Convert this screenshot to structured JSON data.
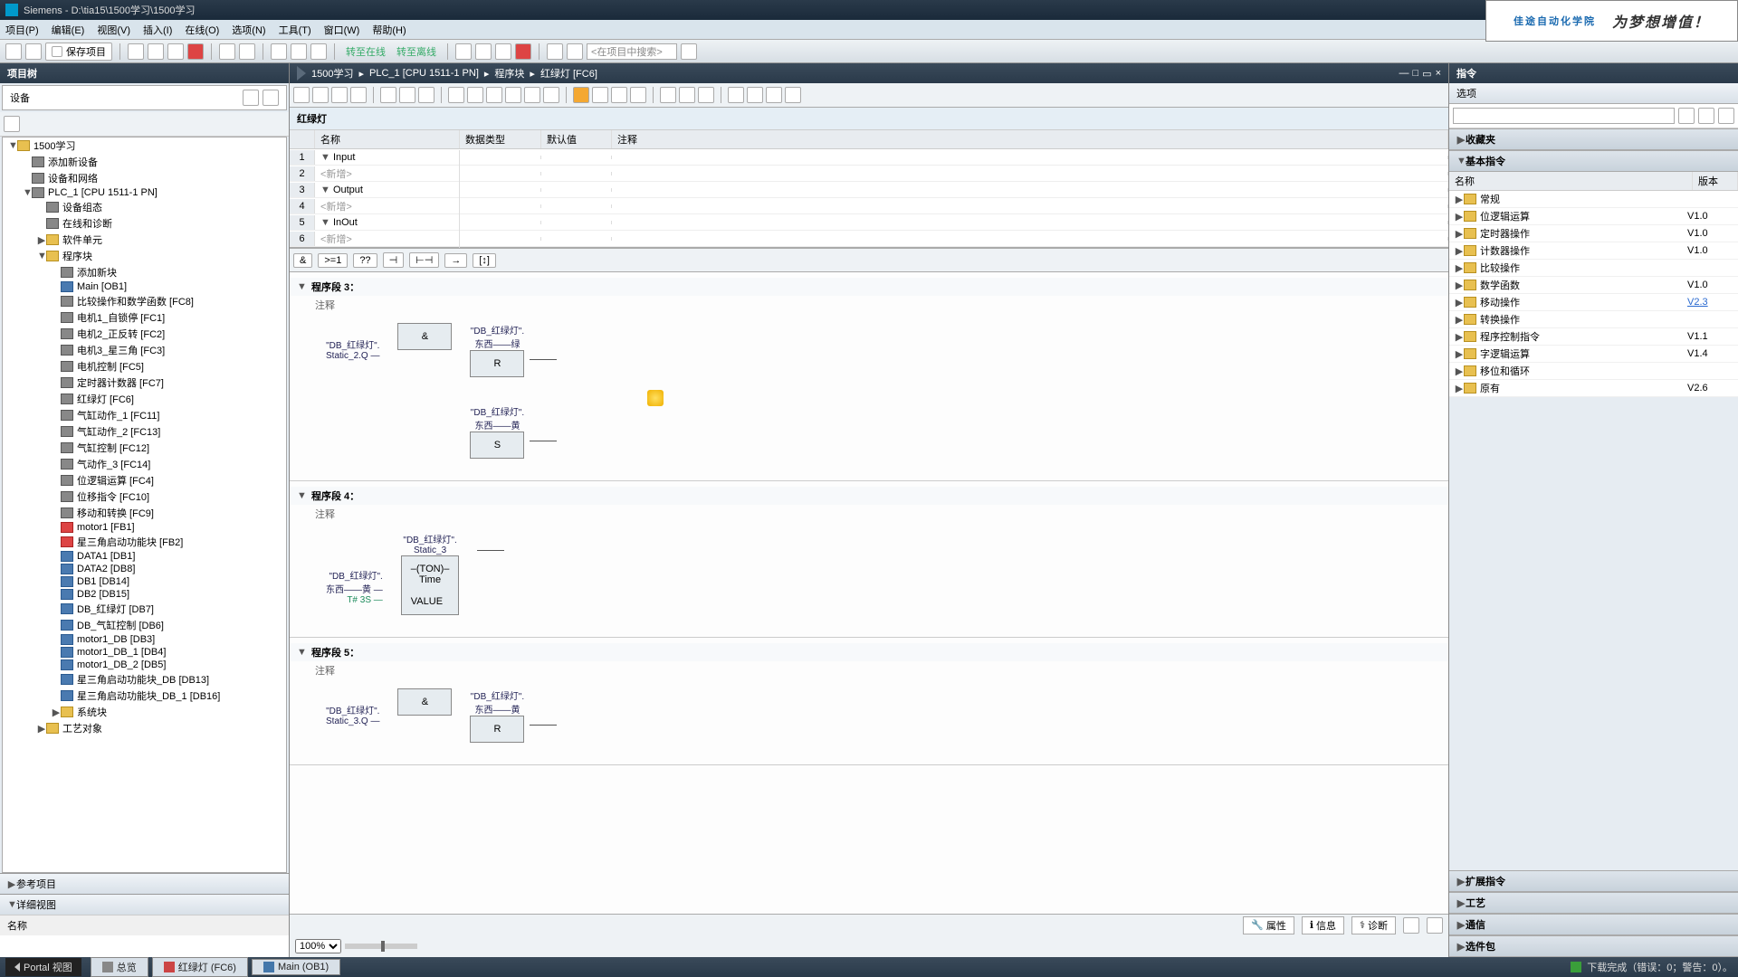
{
  "title": "Siemens  -  D:\\tia15\\1500学习\\1500学习",
  "menus": [
    "项目(P)",
    "编辑(E)",
    "视图(V)",
    "插入(I)",
    "在线(O)",
    "选项(N)",
    "工具(T)",
    "窗口(W)",
    "帮助(H)"
  ],
  "toolbar": {
    "save": "保存项目",
    "go_online": "转至在线",
    "go_offline": "转至离线",
    "search_ph": "<在项目中搜索>"
  },
  "brand": {
    "main": "佳途自动化学院",
    "side": "为梦想增值！"
  },
  "left": {
    "pane": "项目树",
    "devices": "设备",
    "tree": [
      {
        "t": "▼",
        "ic": "folder-ic",
        "lbl": "1500学习",
        "ind": 0
      },
      {
        "t": "",
        "ic": "dev-ic",
        "lbl": "添加新设备",
        "ind": 1
      },
      {
        "t": "",
        "ic": "dev-ic",
        "lbl": "设备和网络",
        "ind": 1
      },
      {
        "t": "▼",
        "ic": "dev-ic",
        "lbl": "PLC_1 [CPU 1511-1 PN]",
        "ind": 1
      },
      {
        "t": "",
        "ic": "dev-ic",
        "lbl": "设备组态",
        "ind": 2
      },
      {
        "t": "",
        "ic": "dev-ic",
        "lbl": "在线和诊断",
        "ind": 2
      },
      {
        "t": "▶",
        "ic": "folder-ic",
        "lbl": "软件单元",
        "ind": 2
      },
      {
        "t": "▼",
        "ic": "folder-ic",
        "lbl": "程序块",
        "ind": 2
      },
      {
        "t": "",
        "ic": "dev-ic",
        "lbl": "添加新块",
        "ind": 3
      },
      {
        "t": "",
        "ic": "db-ic",
        "lbl": "Main [OB1]",
        "ind": 3
      },
      {
        "t": "",
        "ic": "fc-ic",
        "lbl": "比较操作和数学函数 [FC8]",
        "ind": 3
      },
      {
        "t": "",
        "ic": "fc-ic",
        "lbl": "电机1_自锁停 [FC1]",
        "ind": 3
      },
      {
        "t": "",
        "ic": "fc-ic",
        "lbl": "电机2_正反转 [FC2]",
        "ind": 3
      },
      {
        "t": "",
        "ic": "fc-ic",
        "lbl": "电机3_星三角 [FC3]",
        "ind": 3
      },
      {
        "t": "",
        "ic": "fc-ic",
        "lbl": "电机控制 [FC5]",
        "ind": 3
      },
      {
        "t": "",
        "ic": "fc-ic",
        "lbl": "定时器计数器 [FC7]",
        "ind": 3
      },
      {
        "t": "",
        "ic": "fc-ic",
        "lbl": "红绿灯 [FC6]",
        "ind": 3
      },
      {
        "t": "",
        "ic": "fc-ic",
        "lbl": "气缸动作_1 [FC11]",
        "ind": 3
      },
      {
        "t": "",
        "ic": "fc-ic",
        "lbl": "气缸动作_2 [FC13]",
        "ind": 3
      },
      {
        "t": "",
        "ic": "fc-ic",
        "lbl": "气缸控制 [FC12]",
        "ind": 3
      },
      {
        "t": "",
        "ic": "fc-ic",
        "lbl": "气动作_3 [FC14]",
        "ind": 3
      },
      {
        "t": "",
        "ic": "fc-ic",
        "lbl": "位逻辑运算 [FC4]",
        "ind": 3
      },
      {
        "t": "",
        "ic": "fc-ic",
        "lbl": "位移指令 [FC10]",
        "ind": 3
      },
      {
        "t": "",
        "ic": "fc-ic",
        "lbl": "移动和转换 [FC9]",
        "ind": 3
      },
      {
        "t": "",
        "ic": "fb-ic",
        "lbl": "motor1 [FB1]",
        "ind": 3
      },
      {
        "t": "",
        "ic": "fb-ic",
        "lbl": "星三角启动功能块 [FB2]",
        "ind": 3
      },
      {
        "t": "",
        "ic": "db-ic",
        "lbl": "DATA1 [DB1]",
        "ind": 3
      },
      {
        "t": "",
        "ic": "db-ic",
        "lbl": "DATA2 [DB8]",
        "ind": 3
      },
      {
        "t": "",
        "ic": "db-ic",
        "lbl": "DB1 [DB14]",
        "ind": 3
      },
      {
        "t": "",
        "ic": "db-ic",
        "lbl": "DB2 [DB15]",
        "ind": 3
      },
      {
        "t": "",
        "ic": "db-ic",
        "lbl": "DB_红绿灯 [DB7]",
        "ind": 3
      },
      {
        "t": "",
        "ic": "db-ic",
        "lbl": "DB_气缸控制 [DB6]",
        "ind": 3
      },
      {
        "t": "",
        "ic": "db-ic",
        "lbl": "motor1_DB [DB3]",
        "ind": 3
      },
      {
        "t": "",
        "ic": "db-ic",
        "lbl": "motor1_DB_1 [DB4]",
        "ind": 3
      },
      {
        "t": "",
        "ic": "db-ic",
        "lbl": "motor1_DB_2 [DB5]",
        "ind": 3
      },
      {
        "t": "",
        "ic": "db-ic",
        "lbl": "星三角启动功能块_DB [DB13]",
        "ind": 3
      },
      {
        "t": "",
        "ic": "db-ic",
        "lbl": "星三角启动功能块_DB_1 [DB16]",
        "ind": 3
      },
      {
        "t": "▶",
        "ic": "folder-ic",
        "lbl": "系统块",
        "ind": 3
      },
      {
        "t": "▶",
        "ic": "folder-ic",
        "lbl": "工艺对象",
        "ind": 2
      }
    ],
    "ref": "参考项目",
    "detail": "详细视图",
    "name_hdr": "名称"
  },
  "center": {
    "crumbs": [
      "1500学习",
      "PLC_1 [CPU 1511-1 PN]",
      "程序块",
      "红绿灯 [FC6]"
    ],
    "fc_name": "红绿灯",
    "var_cols": {
      "name": "名称",
      "type": "数据类型",
      "def": "默认值",
      "cmt": "注释"
    },
    "vars": [
      {
        "n": "1",
        "t": "▼",
        "lbl": "Input"
      },
      {
        "n": "2",
        "t": "",
        "lbl": "<新增>",
        "new": true
      },
      {
        "n": "3",
        "t": "▼",
        "lbl": "Output"
      },
      {
        "n": "4",
        "t": "",
        "lbl": "<新增>",
        "new": true
      },
      {
        "n": "5",
        "t": "▼",
        "lbl": "InOut"
      },
      {
        "n": "6",
        "t": "",
        "lbl": "<新增>",
        "new": true
      }
    ],
    "net_ops": [
      "&",
      ">=1",
      "??",
      "⊣",
      "⊢⊣",
      "→",
      "[↕]"
    ],
    "nets": {
      "n3": {
        "title": "程序段 3：",
        "cmt": "注释",
        "in_lbl": "\"DB_红绿灯\".",
        "in_lbl2": "Static_2.Q —",
        "and": "&",
        "r_top": "\"DB_红绿灯\".",
        "r_top2": "东西——绿",
        "r": "R",
        "s_top": "\"DB_红绿灯\".",
        "s_top2": "东西——黄",
        "s": "S"
      },
      "n4": {
        "title": "程序段 4：",
        "cmt": "注释",
        "top": "\"DB_红绿灯\".",
        "top2": "Static_3",
        "ton": "–(TON)–",
        "time": "Time",
        "in_lbl": "\"DB_红绿灯\".",
        "in_lbl2": "东西——黄 —",
        "t": "T# 3S —",
        "val": "VALUE"
      },
      "n5": {
        "title": "程序段 5：",
        "cmt": "注释",
        "in_lbl": "\"DB_红绿灯\".",
        "in_lbl2": "Static_3.Q —",
        "and": "&",
        "r_top": "\"DB_红绿灯\".",
        "r_top2": "东西——黄",
        "r": "R"
      }
    },
    "footer": {
      "prop": "属性",
      "info": "信息",
      "diag": "诊断",
      "zoom": "100%"
    }
  },
  "right": {
    "pane": "指令",
    "options": "选项",
    "fav": "收藏夹",
    "basic": "基本指令",
    "cols": {
      "name": "名称",
      "ver": "版本"
    },
    "items": [
      {
        "lbl": "常规",
        "ver": ""
      },
      {
        "lbl": "位逻辑运算",
        "ver": "V1.0"
      },
      {
        "lbl": "定时器操作",
        "ver": "V1.0"
      },
      {
        "lbl": "计数器操作",
        "ver": "V1.0"
      },
      {
        "lbl": "比较操作",
        "ver": ""
      },
      {
        "lbl": "数学函数",
        "ver": "V1.0"
      },
      {
        "lbl": "移动操作",
        "ver": "V2.3",
        "link": true
      },
      {
        "lbl": "转换操作",
        "ver": ""
      },
      {
        "lbl": "程序控制指令",
        "ver": "V1.1"
      },
      {
        "lbl": "字逻辑运算",
        "ver": "V1.4"
      },
      {
        "lbl": "移位和循环",
        "ver": ""
      },
      {
        "lbl": "原有",
        "ver": "V2.6"
      }
    ],
    "secs": [
      "扩展指令",
      "工艺",
      "通信",
      "选件包"
    ]
  },
  "status": {
    "portal": "Portal 视图",
    "tabs": [
      "总览",
      "红绿灯 (FC6)",
      "Main (OB1)"
    ],
    "msg": "下载完成（错误：0；警告：0）。"
  }
}
